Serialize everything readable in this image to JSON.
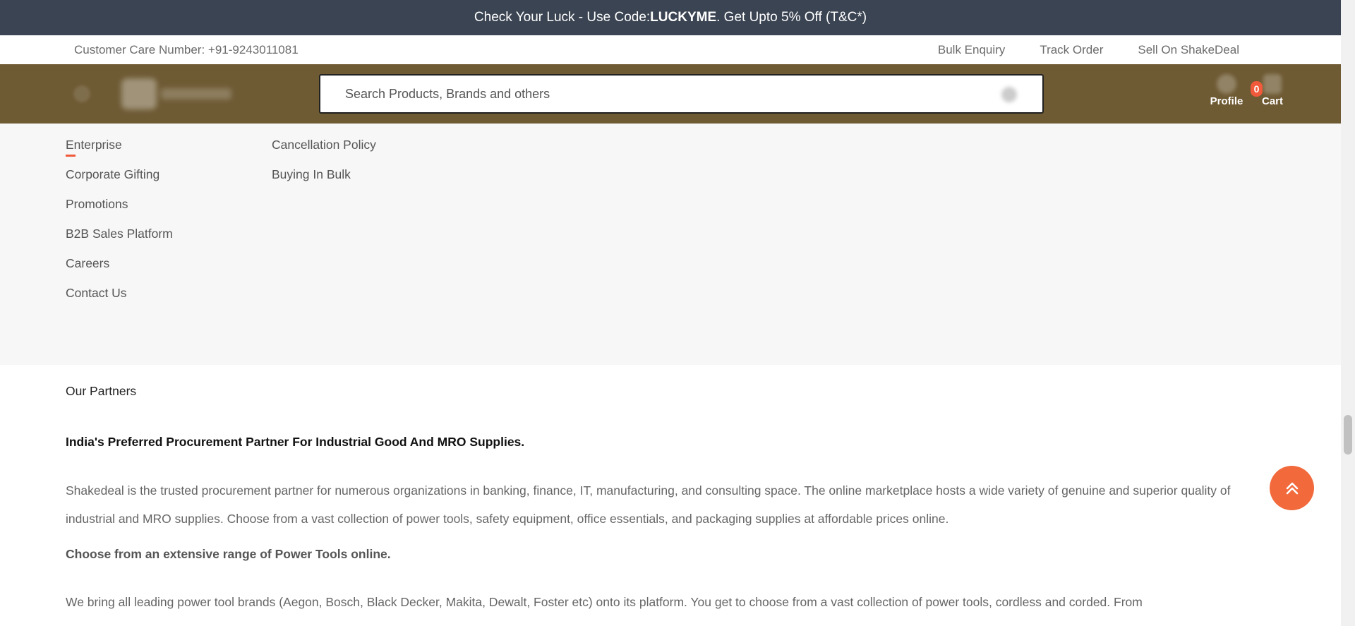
{
  "promo": {
    "prefix": "Check Your Luck - Use Code: ",
    "code": "LUCKYME",
    "suffix": ". Get Upto 5% Off (T&C*)"
  },
  "utility": {
    "customer_care": "Customer Care Number: +91-9243011081",
    "links": [
      "Bulk Enquiry",
      "Track Order",
      "Sell On ShakeDeal"
    ]
  },
  "header": {
    "search_placeholder": "Search Products, Brands and others",
    "profile_label": "Profile",
    "cart_label": "Cart",
    "cart_count": "0",
    "brand_color": "#6e5a33",
    "accent_color": "#f05a3a"
  },
  "footer": {
    "column1": [
      "Enterprise",
      "Corporate Gifting",
      "Promotions",
      "B2B Sales Platform",
      "Careers",
      "Contact Us"
    ],
    "column2": [
      "Cancellation Policy",
      "Buying In Bulk"
    ]
  },
  "partners": {
    "title": "Our Partners",
    "heading1": "India's Preferred Procurement Partner For Industrial Good And MRO Supplies.",
    "paragraph1": "Shakedeal is the trusted procurement partner for numerous organizations in banking, finance, IT, manufacturing, and consulting space. The online marketplace hosts a wide variety of genuine and superior quality of industrial and MRO supplies. Choose from a vast collection of power tools, safety equipment, office essentials, and packaging supplies at affordable prices online.",
    "heading2": "Choose from an extensive range of Power Tools online.",
    "paragraph2": "We bring all leading power tool brands (Aegon, Bosch, Black Decker, Makita, Dewalt, Foster etc) onto its platform. You get to choose from a vast collection of power tools, cordless and corded. From"
  },
  "icons": {
    "menu": "menu-icon",
    "logo": "shakedeal-logo",
    "search": "search-icon",
    "profile": "user-icon",
    "cart": "cart-icon",
    "scroll_top": "double-chevron-up-icon"
  }
}
